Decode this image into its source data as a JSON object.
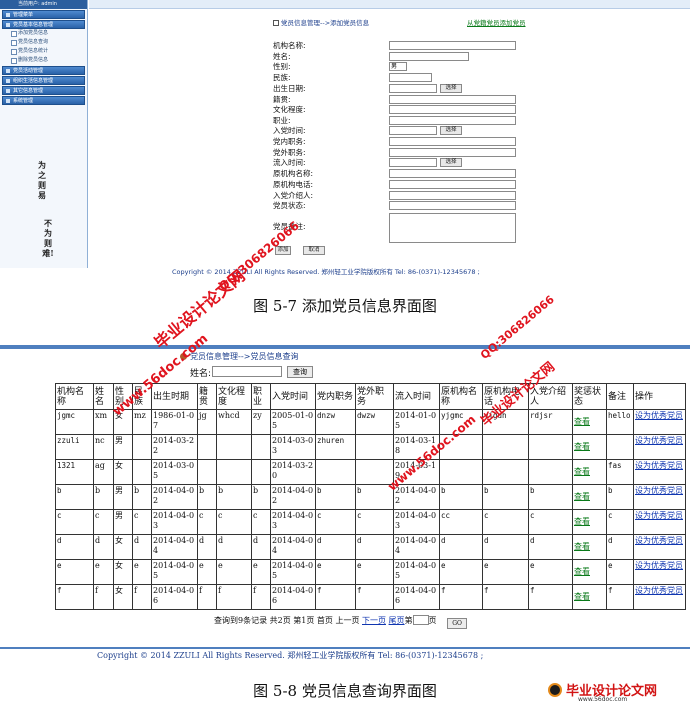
{
  "fig1": {
    "sidebar": {
      "user_line": "当前用户: admin",
      "title": "管理菜单",
      "group1": "党员基本信息管理",
      "items": [
        "添加党员信息",
        "党员信息查询",
        "党员信息统计",
        "删除党员信息"
      ],
      "groups": [
        "党员活动管理",
        "组织生活信息管理",
        "其它信息管理",
        "系统管理"
      ],
      "vert1": "为之则易",
      "vert2": "不为则难!"
    },
    "breadcrumb": "党员信息管理-->添加党员信息",
    "batch_link": "从党籍党员添加党员",
    "form": {
      "labels": [
        "机构名称:",
        "姓名:",
        "性别:",
        "民族:",
        "出生日期:",
        "籍贯:",
        "文化程度:",
        "职业:",
        "入党时间:",
        "党内职务:",
        "党外职务:",
        "流入时间:",
        "原机构名称:",
        "原机构电话:",
        "入党介绍人:",
        "党员状态:",
        "党员备注:"
      ],
      "gender_value": "男",
      "choose_label": "选择",
      "add_label": "添加",
      "cancel_label": "取消"
    },
    "footer": "Copyright © 2014 ZZULI All Rights Reserved.    郑州轻工业学院版权所有    Tel: 86-(0371)-12345678 ;",
    "caption": "图 5-7  添加党员信息界面图"
  },
  "fig2": {
    "breadcrumb": "党员信息管理-->党员信息查询",
    "search": {
      "label": "姓名:",
      "value": "",
      "button": "查询"
    },
    "columns": [
      "机构名称",
      "姓名",
      "性别",
      "民族",
      "出生时期",
      "籍贯",
      "文化程度",
      "职业",
      "入党时间",
      "党内职务",
      "党外职务",
      "流入时间",
      "原机构名称",
      "原机构电话",
      "入党介绍人",
      "奖惩状态",
      "备注",
      "操作"
    ],
    "rows": [
      [
        "jgmc",
        "xm",
        "女",
        "mz",
        "1986-01-07",
        "jg",
        "whcd",
        "zy",
        "2005-01-05",
        "dnzw",
        "dwzw",
        "2014-01-05",
        "yjgmc",
        "yjgdh",
        "rdjsr",
        "查看",
        "hello",
        "设为优秀党员"
      ],
      [
        "zzuli",
        "nc",
        "男",
        "",
        "2014-03-22",
        "",
        "",
        "",
        "2014-03-03",
        "zhuren",
        "",
        "2014-03-18",
        "",
        "",
        "",
        "查看",
        "",
        "设为优秀党员"
      ],
      [
        "1321",
        "ag",
        "女",
        "",
        "2014-03-05",
        "",
        "",
        "",
        "2014-03-20",
        "",
        "",
        "2014-03-19",
        "",
        "",
        "",
        "查看",
        "fas",
        "设为优秀党员"
      ],
      [
        "b",
        "b",
        "男",
        "b",
        "2014-04-02",
        "b",
        "b",
        "b",
        "2014-04-02",
        "b",
        "b",
        "2014-04-02",
        "b",
        "b",
        "b",
        "查看",
        "b",
        "设为优秀党员"
      ],
      [
        "c",
        "c",
        "男",
        "c",
        "2014-04-03",
        "c",
        "c",
        "c",
        "2014-04-03",
        "c",
        "c",
        "2014-04-03",
        "cc",
        "c",
        "c",
        "查看",
        "c",
        "设为优秀党员"
      ],
      [
        "d",
        "d",
        "女",
        "d",
        "2014-04-04",
        "d",
        "d",
        "d",
        "2014-04-04",
        "d",
        "d",
        "2014-04-04",
        "d",
        "d",
        "d",
        "查看",
        "d",
        "设为优秀党员"
      ],
      [
        "e",
        "e",
        "女",
        "e",
        "2014-04-05",
        "e",
        "e",
        "e",
        "2014-04-05",
        "e",
        "e",
        "2014-04-05",
        "e",
        "e",
        "e",
        "查看",
        "e",
        "设为优秀党员"
      ],
      [
        "f",
        "f",
        "女",
        "f",
        "2014-04-06",
        "f",
        "f",
        "f",
        "2014-04-06",
        "f",
        "f",
        "2014-04-06",
        "f",
        "f",
        "f",
        "查看",
        "f",
        "设为优秀党员"
      ]
    ],
    "pager": {
      "summary": "查询到9条记录  共2页  第1页  首页  上一页",
      "next": "下一页",
      "last": "尾页",
      "goto_prefix": "第",
      "goto_suffix": "页",
      "go": "GO"
    },
    "footer": "Copyright © 2014 ZZULI All Rights Reserved.    郑州轻工业学院版权所有    Tel: 86-(0371)-12345678 ;",
    "caption": "图 5-8  党员信息查询界面图"
  },
  "watermarks": {
    "site1": "毕业设计论文网",
    "site2": "www.56doc.com",
    "qq": "QQ:306826066",
    "logo": "毕业设计论文网",
    "logo_sub": "www.56doc.com"
  },
  "colors": {
    "brand_blue": "#2b5e9e",
    "link_blue": "#1036b0",
    "link_green": "#0a7a1a",
    "watermark_red": "#e0141e"
  }
}
